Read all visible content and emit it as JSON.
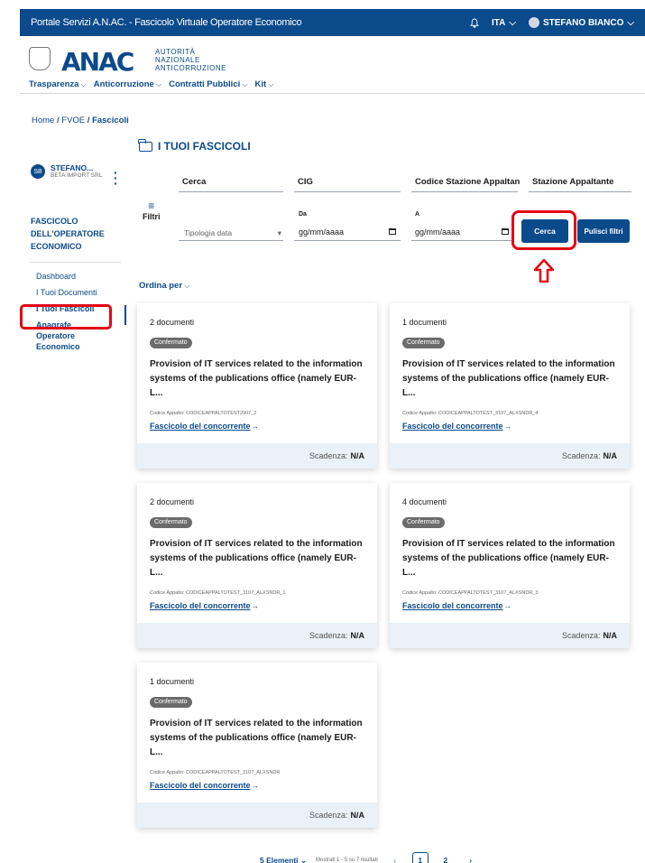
{
  "topbar": {
    "title": "Portale Servizi A.N.AC. - Fascicolo Virtuale Operatore Economico",
    "language": "ITA",
    "user": "STEFANO BIANCO"
  },
  "header": {
    "logo": "ANAC",
    "logo_line1": "AUTORITÀ",
    "logo_line2": "NAZIONALE",
    "logo_line3": "ANTICORRUZIONE",
    "nav": [
      "Trasparenza",
      "Anticorruzione",
      "Contratti Pubblici",
      "Kit"
    ]
  },
  "breadcrumb": {
    "home": "Home",
    "fvoe": "FVOE",
    "current": "Fascicoli",
    "sep": "/"
  },
  "page_title": "I TUOI FASCICOLI",
  "sidebar": {
    "avatar": "SB",
    "user_name": "STEFANO...",
    "company": "BETA IMPORT SRL",
    "section_title": "FASCICOLO DELL'OPERATORE ECONOMICO",
    "items": [
      "Dashboard",
      "I Tuoi Documenti",
      "I Tuoi Fascicoli",
      "Anagrafe Operatore Economico"
    ]
  },
  "filters": {
    "search_placeholder": "Cerca",
    "cig_placeholder": "CIG",
    "codice_placeholder": "Codice Stazione Appaltan",
    "stazione_placeholder": "Stazione Appaltante",
    "filtri_label": "Filtri",
    "tipologia_placeholder": "Tipologia data",
    "da_label": "Da",
    "a_label": "A",
    "date_placeholder": "gg/mm/aaaa",
    "cerca_button": "Cerca",
    "pulisci_button": "Pulisci filtri"
  },
  "sort_label": "Ordina per",
  "cards": [
    {
      "docs": "2 documenti",
      "status": "Confermato",
      "title": "Provision of IT services related to the information systems of the publications office (namely EUR-L...",
      "code": "Codice Appalto: CODICEAPPALTOTEST2907_2",
      "link": "Fascicolo del concorrente",
      "deadline_label": "Scadenza:",
      "deadline": "N/A"
    },
    {
      "docs": "1 documenti",
      "status": "Confermato",
      "title": "Provision of IT services related to the information systems of the publications office (namely EUR-L...",
      "code": "Codice Appalto: CODICEAPPALTOTEST_3107_ALXSNDR_4",
      "link": "Fascicolo del concorrente",
      "deadline_label": "Scadenza:",
      "deadline": "N/A"
    },
    {
      "docs": "2 documenti",
      "status": "Confermato",
      "title": "Provision of IT services related to the information systems of the publications office (namely EUR-L...",
      "code": "Codice Appalto: CODICEAPPALTOTEST_3107_ALXSNDR_1",
      "link": "Fascicolo del concorrente",
      "deadline_label": "Scadenza:",
      "deadline": "N/A"
    },
    {
      "docs": "4 documenti",
      "status": "Confermato",
      "title": "Provision of IT services related to the information systems of the publications office (namely EUR-L...",
      "code": "Codice Appalto: CODICEAPPALTOTEST_3107_ALXSNDR_3",
      "link": "Fascicolo del concorrente",
      "deadline_label": "Scadenza:",
      "deadline": "N/A"
    },
    {
      "docs": "1 documenti",
      "status": "Confermato",
      "title": "Provision of IT services related to the information systems of the publications office (namely EUR-L...",
      "code": "Codice Appalto: CODICEAPPALTOTEST_3107_ALXSNDR",
      "link": "Fascicolo del concorrente",
      "deadline_label": "Scadenza:",
      "deadline": "N/A"
    }
  ],
  "pagination": {
    "elements": "5 Elementi",
    "showing": "Mostrati 1 - 5 su 7 risultati",
    "pages": [
      "1",
      "2"
    ],
    "prev": "‹",
    "next": "›"
  },
  "colors": {
    "primary": "#0b4a8b",
    "highlight": "#e30613",
    "card_footer": "#eaf1f8"
  },
  "icons": [
    "bell-icon",
    "user-icon",
    "folder-icon",
    "filter-icon",
    "calendar-icon",
    "kebab-menu-icon",
    "arrow-up-icon",
    "arrow-right-icon"
  ]
}
